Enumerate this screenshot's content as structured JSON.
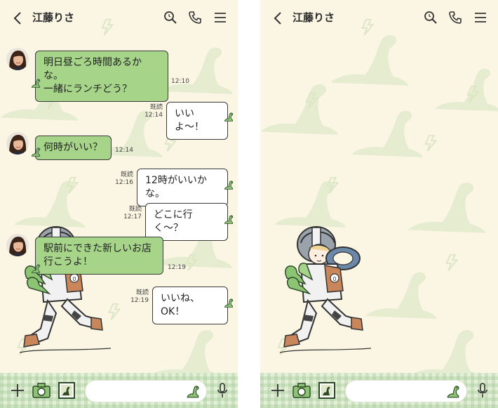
{
  "colors": {
    "background": "#fbf6e4",
    "bubble_in": "#a6d58a",
    "bubble_out": "#ffffff",
    "dino": "#8cc474"
  },
  "left": {
    "header": {
      "title": "江藤りさ",
      "icons": [
        "back-icon",
        "search-icon",
        "phone-icon",
        "menu-icon"
      ]
    },
    "messages": [
      {
        "from": "them",
        "text": "明日昼ごろ時間あるかな。\n一緒にランチどう？",
        "time": "12:10"
      },
      {
        "from": "me",
        "text": "いいよ〜！",
        "read": "既読",
        "time": "12:14"
      },
      {
        "from": "them",
        "text": "何時がいい？",
        "time": "12:14"
      },
      {
        "from": "me",
        "text": "12時がいいかな。",
        "read": "既読",
        "time": "12:16"
      },
      {
        "from": "me",
        "text": "どこに行く〜？",
        "read": "既読",
        "time": "12:17"
      },
      {
        "from": "them",
        "text": "駅前にできた新しいお店\n行こうよ！",
        "time": "12:19"
      },
      {
        "from": "me",
        "text": "いいね、OK！",
        "read": "既読",
        "time": "12:19"
      }
    ],
    "bottom_bar": {
      "icons": [
        "plus-icon",
        "camera-icon",
        "photo-icon",
        "dino-sticker-icon",
        "mic-icon"
      ]
    }
  },
  "right": {
    "header": {
      "title": "江藤りさ",
      "icons": [
        "back-icon",
        "search-icon",
        "phone-icon",
        "menu-icon"
      ]
    },
    "bottom_bar": {
      "icons": [
        "plus-icon",
        "camera-icon",
        "photo-icon",
        "dino-sticker-icon",
        "mic-icon"
      ]
    }
  }
}
